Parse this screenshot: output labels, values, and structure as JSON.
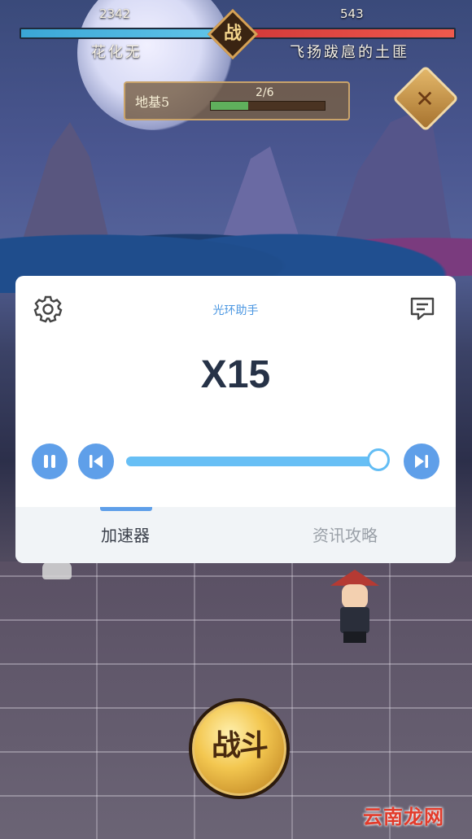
{
  "hud": {
    "player_hp": "2342",
    "enemy_hp": "543",
    "player_name": "花化无",
    "enemy_name": "飞扬跋扈的土匪",
    "vs_label": "战",
    "level_label": "地基5",
    "level_progress": "2/6",
    "level_progress_fraction": 0.33,
    "skip_icon": "crossed-swords-icon"
  },
  "fight_button": {
    "label": "战斗"
  },
  "watermark": "云南龙网",
  "panel": {
    "title": "光环助手",
    "settings_icon": "gear-icon",
    "message_icon": "message-icon",
    "speed_value": "X15",
    "slider_fraction": 1.0,
    "tabs": [
      {
        "label": "加速器",
        "active": true
      },
      {
        "label": "资讯攻略",
        "active": false
      }
    ],
    "accent_color": "#5f9fe9"
  }
}
